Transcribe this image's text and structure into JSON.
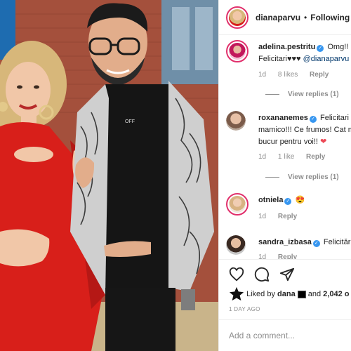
{
  "post": {
    "username": "dianaparvu",
    "separator": "•",
    "follow_label": "Following"
  },
  "comments": [
    {
      "username": "adelina.pestritu",
      "text_parts": [
        "Omg!! Felicitari♥♥♥ ",
        "@dianaparvu"
      ],
      "time": "1d",
      "likes": "8 likes",
      "reply": "Reply",
      "view_replies": "View replies (1)"
    },
    {
      "username": "roxananemes",
      "text": "Felicitari mamico!!! Ce frumos! Cat ma bucur pentru voi!! ",
      "emoji": "❤",
      "time": "1d",
      "likes": "1 like",
      "reply": "Reply",
      "view_replies": "View replies (1)"
    },
    {
      "username": "otniela",
      "emoji": "😍",
      "time": "1d",
      "reply": "Reply"
    },
    {
      "username": "sandra_izbasa",
      "text": "Felicitări",
      "time": "1d",
      "reply": "Reply"
    }
  ],
  "actions": {
    "like_icon": "heart-outline-icon",
    "comment_icon": "comment-icon",
    "share_icon": "paper-plane-icon"
  },
  "likes": {
    "prefix": "Liked by ",
    "user": "dana",
    "connector": " and ",
    "count": "2,042 o"
  },
  "timestamp": "1 DAY AGO",
  "add_comment": {
    "placeholder": "Add a comment..."
  },
  "colors": {
    "verified": "#3897f0",
    "dress": "#d81f1a",
    "wall": "#a9503a",
    "link": "#00376b"
  }
}
